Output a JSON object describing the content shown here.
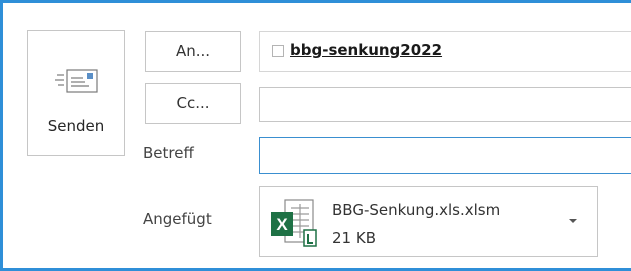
{
  "send_button": {
    "label": "Senden",
    "icon": "send-envelope-icon"
  },
  "fields": {
    "to": {
      "button_label": "An...",
      "recipient": "bbg-senkung2022"
    },
    "cc": {
      "button_label": "Cc...",
      "value": ""
    },
    "subject": {
      "label": "Betreff",
      "value": ""
    }
  },
  "attachment": {
    "label": "Angefügt",
    "file_name": "BBG-Senkung.xls.xlsm",
    "file_size": "21 KB",
    "icon": "excel-file-icon",
    "menu_icon": "dropdown-arrow-icon"
  },
  "colors": {
    "frame_border": "#2f8fd8",
    "subject_focus_border": "#3a8fd0",
    "excel_green": "#1e7145"
  }
}
